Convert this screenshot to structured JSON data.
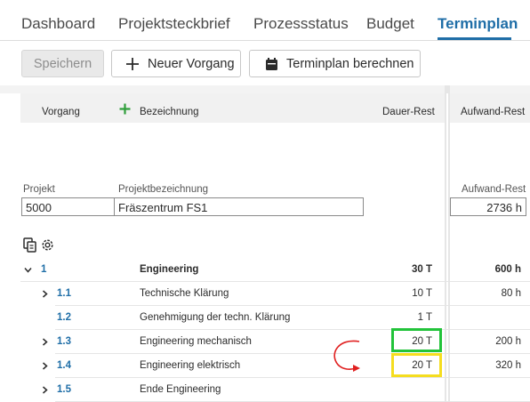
{
  "tabs": [
    {
      "label": "Dashboard",
      "active": false
    },
    {
      "label": "Projektsteckbrief",
      "active": false
    },
    {
      "label": "Prozessstatus",
      "active": false
    },
    {
      "label": "Budget",
      "active": false
    },
    {
      "label": "Terminplan",
      "active": true
    }
  ],
  "toolbar": {
    "save_label": "Speichern",
    "new_task_label": "Neuer Vorgang",
    "calc_label": "Terminplan berechnen"
  },
  "columns": {
    "vorgang": "Vorgang",
    "bezeichnung": "Bezeichnung",
    "dauer_rest": "Dauer-Rest",
    "aufwand_rest": "Aufwand-Rest"
  },
  "project": {
    "projekt_label": "Projekt",
    "projekt_value": "5000",
    "bezeichnung_label": "Projektbezeichnung",
    "bezeichnung_value": "Fräszentrum FS1",
    "aufwand_label": "Aufwand-Rest",
    "aufwand_value": "2736 h"
  },
  "rows": [
    {
      "id": "1",
      "name": "Engineering",
      "dauer": "30 T",
      "aufwand": "600 h",
      "expandable": true,
      "expanded": true,
      "bold": true
    },
    {
      "id": "1.1",
      "name": "Technische Klärung",
      "dauer": "10 T",
      "aufwand": "80 h",
      "expandable": true
    },
    {
      "id": "1.2",
      "name": "Genehmigung der techn. Klärung",
      "dauer": "1 T",
      "aufwand": "",
      "expandable": false
    },
    {
      "id": "1.3",
      "name": "Engineering mechanisch",
      "dauer": "20 T",
      "aufwand": "200 h",
      "expandable": true,
      "highlight": "green"
    },
    {
      "id": "1.4",
      "name": "Engineering elektrisch",
      "dauer": "20 T",
      "aufwand": "320 h",
      "expandable": true,
      "highlight": "yellow"
    },
    {
      "id": "1.5",
      "name": "Ende Engineering",
      "dauer": "",
      "aufwand": "",
      "expandable": true
    }
  ],
  "colors": {
    "accent": "#1f6ea7",
    "add_green": "#2e9e3a",
    "highlight_green": "#22c33a",
    "highlight_yellow": "#f5dd1f",
    "arrow_red": "#e02020"
  }
}
